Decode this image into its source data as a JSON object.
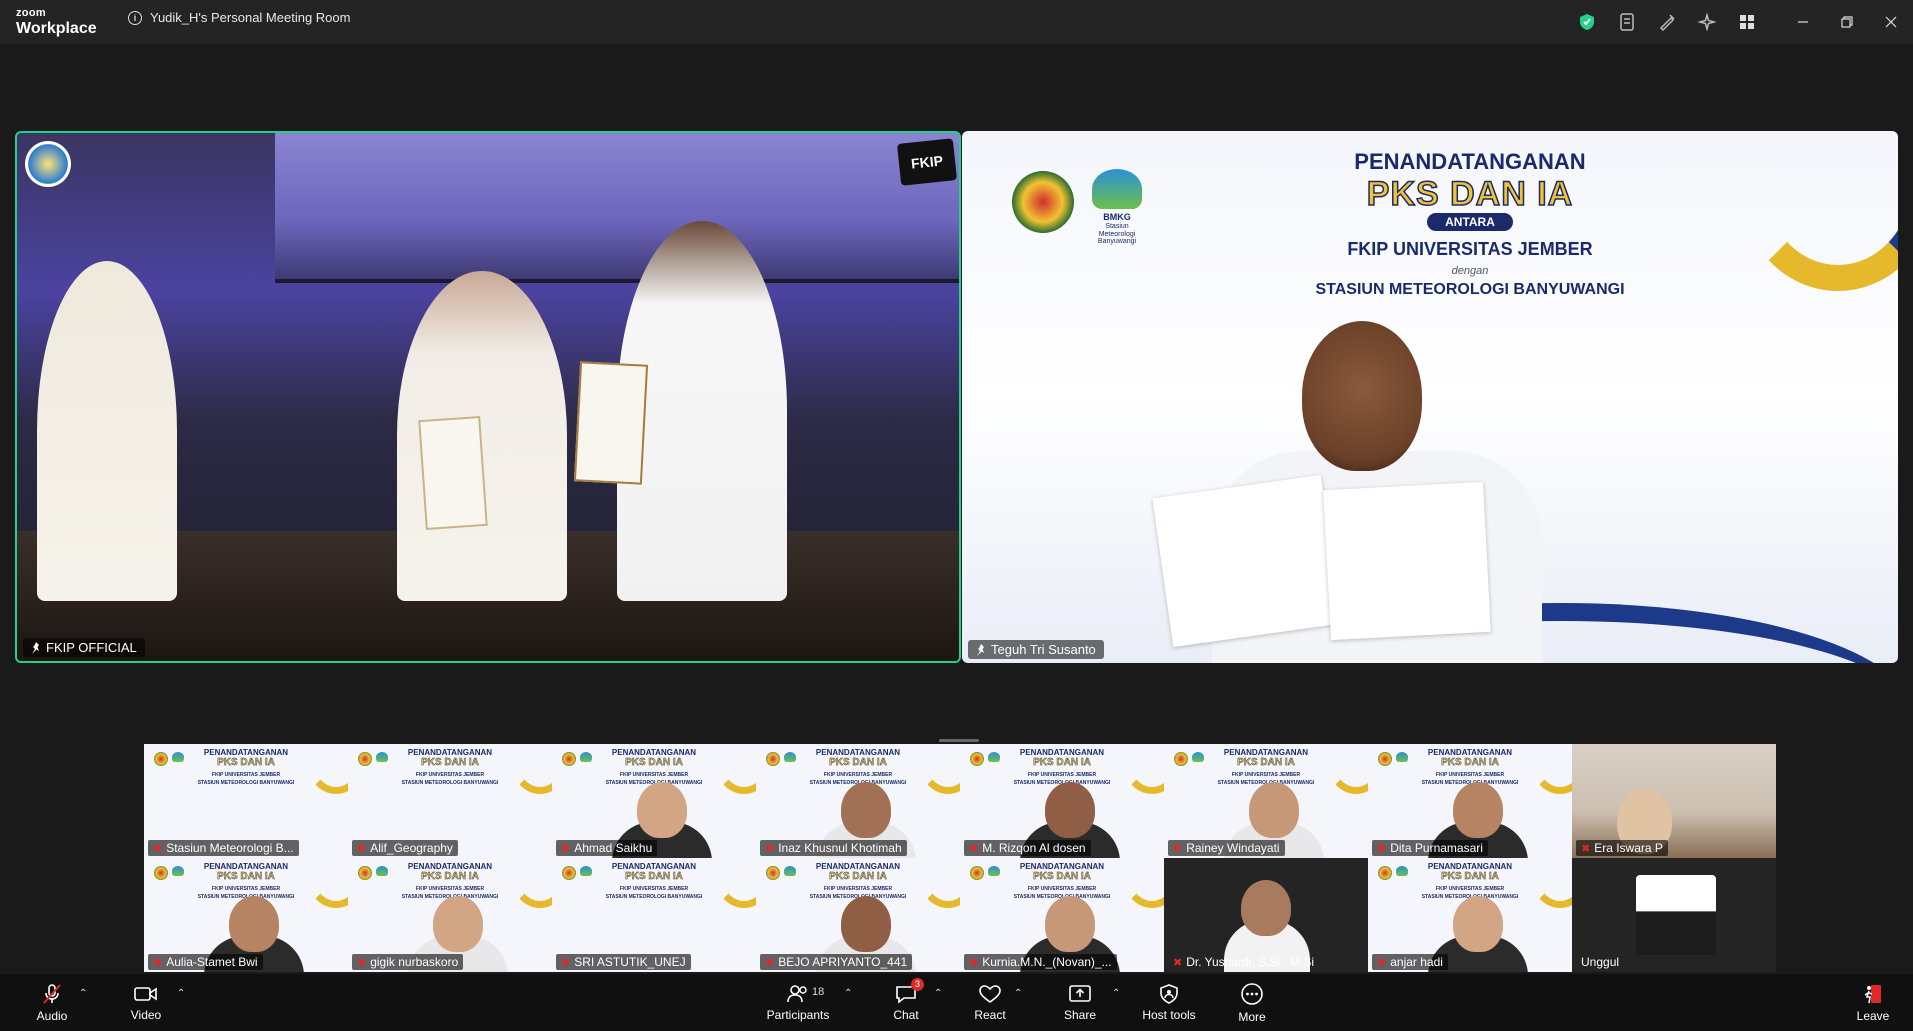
{
  "titlebar": {
    "brand_small": "zoom",
    "brand_large": "Workplace",
    "meeting_title": "Yudik_H's Personal Meeting Room"
  },
  "main_tiles": [
    {
      "name": "FKIP OFFICIAL",
      "fkip_logo": "FKIP"
    },
    {
      "name": "Teguh Tri Susanto"
    }
  ],
  "banner": {
    "line1": "PENANDATANGANAN",
    "line2": "PKS DAN IA",
    "line3": "ANTARA",
    "line4": "FKIP UNIVERSITAS JEMBER",
    "line5": "dengan",
    "line6": "STASIUN METEOROLOGI BANYUWANGI",
    "bmkg_label": "BMKG",
    "bmkg_sub": "Stasiun Meteorologi Banyuwangi"
  },
  "thumbnail_banner": {
    "title": "PENANDATANGANAN",
    "pks": "PKS DAN IA",
    "sub1": "FKIP UNIVERSITAS JEMBER",
    "sub2": "STASIUN METEOROLOGI BANYUWANGI"
  },
  "participants_row1": [
    {
      "name": "Stasiun Meteorologi B..."
    },
    {
      "name": "Alif_Geography"
    },
    {
      "name": "Ahmad Saikhu"
    },
    {
      "name": "Inaz Khusnul Khotimah"
    },
    {
      "name": "M. Rizqon Al dosen"
    },
    {
      "name": "Rainey Windayati"
    },
    {
      "name": "Dita Purnamasari"
    },
    {
      "name": "Era Iswara P"
    }
  ],
  "participants_row2": [
    {
      "name": "Aulia-Stamet Bwi"
    },
    {
      "name": "gigik nurbaskoro"
    },
    {
      "name": "SRI ASTUTIK_UNEJ"
    },
    {
      "name": "BEJO APRIYANTO_441"
    },
    {
      "name": "Kurnia.M.N._(Novan)_..."
    },
    {
      "name": "Dr. Yushardi, S.Si., M.Si"
    },
    {
      "name": "anjar hadi"
    },
    {
      "name": "Unggul"
    }
  ],
  "toolbar": {
    "audio": "Audio",
    "video": "Video",
    "participants": "Participants",
    "participants_count": "18",
    "chat": "Chat",
    "chat_badge": "3",
    "react": "React",
    "share": "Share",
    "host_tools": "Host tools",
    "more": "More",
    "leave": "Leave"
  },
  "colors": {
    "active_speaker_border": "#23d18b",
    "leave": "#e02828",
    "security_shield": "#23d18b"
  }
}
